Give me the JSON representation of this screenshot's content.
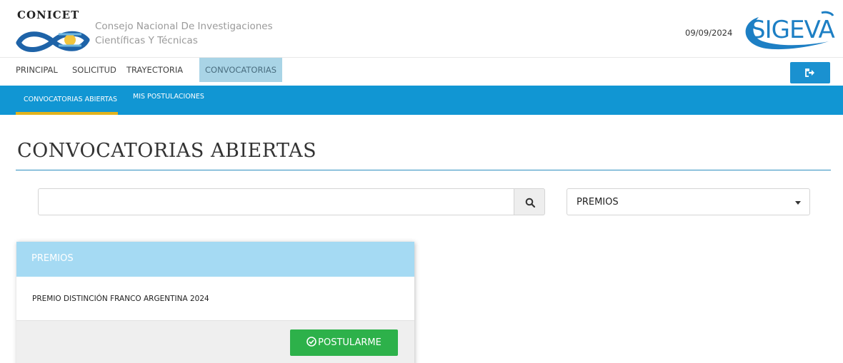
{
  "header": {
    "logo_text": "CONICET",
    "org_line1": "Consejo Nacional De Investigaciones",
    "org_line2": "Científicas Y Técnicas",
    "date": "09/09/2024",
    "brand": "SIGEVA",
    "brand_color": "#1d7fc4"
  },
  "main_nav": {
    "items": [
      {
        "label": "PRINCIPAL"
      },
      {
        "label": "SOLICITUD"
      },
      {
        "label": "TRAYECTORIA"
      },
      {
        "label": "CONVOCATORIAS",
        "active": true
      }
    ],
    "logout_icon": "sign-out-icon"
  },
  "sub_nav": {
    "items": [
      {
        "label": "CONVOCATORIAS ABIERTAS",
        "active": true
      },
      {
        "label": "MIS POSTULACIONES"
      }
    ],
    "bg_color": "#1196d3",
    "active_underline_color": "#e2b31c"
  },
  "page": {
    "title": "CONVOCATORIAS ABIERTAS"
  },
  "search": {
    "value": "",
    "placeholder": "",
    "icon": "search-icon"
  },
  "filter": {
    "selected": "PREMIOS"
  },
  "card": {
    "header": "PREMIOS",
    "item": "PREMIO DISTINCIÓN FRANCO ARGENTINA 2024",
    "button_label": "POSTULARME",
    "button_color": "#2db14a"
  }
}
